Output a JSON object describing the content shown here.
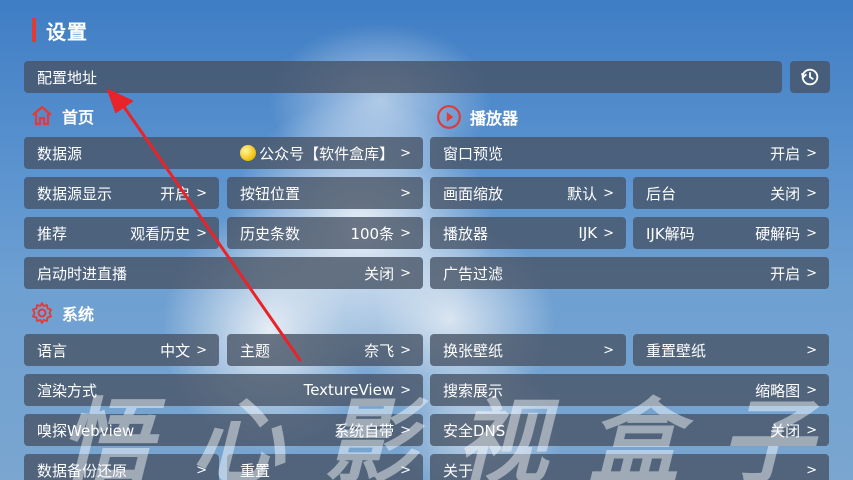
{
  "header": {
    "title": "设置"
  },
  "address": {
    "label": "配置地址"
  },
  "sections": {
    "home": "首页",
    "player": "播放器",
    "system": "系统"
  },
  "home_rows": [
    {
      "label": "数据源",
      "value": "公众号【软件盒库】"
    },
    {
      "label": "数据源显示",
      "value": "开启"
    },
    {
      "label": "按钮位置",
      "value": ""
    },
    {
      "label": "推荐",
      "value": "观看历史"
    },
    {
      "label": "历史条数",
      "value": "100条"
    },
    {
      "label": "启动时进直播",
      "value": "关闭"
    }
  ],
  "player_rows": [
    {
      "label": "窗口预览",
      "value": "开启"
    },
    {
      "label": "画面缩放",
      "value": "默认"
    },
    {
      "label": "后台",
      "value": "关闭"
    },
    {
      "label": "播放器",
      "value": "IJK"
    },
    {
      "label": "IJK解码",
      "value": "硬解码"
    },
    {
      "label": "广告过滤",
      "value": "开启"
    }
  ],
  "system_rows": [
    {
      "label": "语言",
      "value": "中文"
    },
    {
      "label": "主题",
      "value": "奈飞"
    },
    {
      "label": "换张壁纸",
      "value": ""
    },
    {
      "label": "重置壁纸",
      "value": ""
    },
    {
      "label": "渲染方式",
      "value": "TextureView"
    },
    {
      "label": "搜索展示",
      "value": "缩略图"
    },
    {
      "label": "嗅探Webview",
      "value": "系统自带"
    },
    {
      "label": "安全DNS",
      "value": "关闭"
    },
    {
      "label": "数据备份还原",
      "value": ""
    },
    {
      "label": "重置",
      "value": ""
    },
    {
      "label": "关于",
      "value": ""
    }
  ],
  "arrow_glyph": ">",
  "watermark": "悟心影视盒子",
  "colors": {
    "accent": "#e53935",
    "panel": "#465264"
  },
  "icons": [
    "history-icon",
    "home-icon",
    "play-circle-icon",
    "gear-icon",
    "coin-icon",
    "pointer-arrow"
  ]
}
